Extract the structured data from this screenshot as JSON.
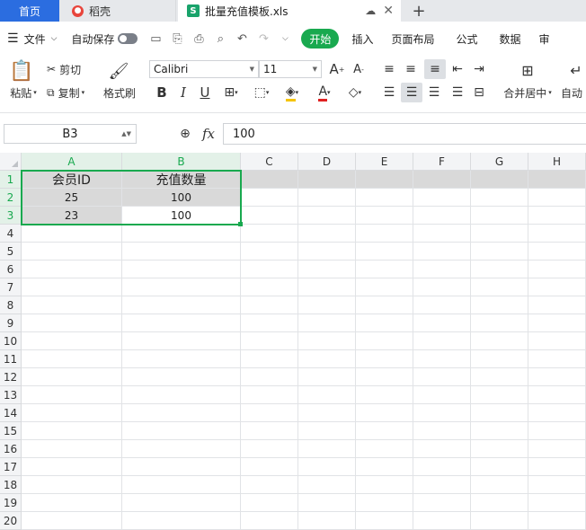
{
  "tabs": {
    "home": "首页",
    "wps": "稻壳",
    "file": "批量充值模板.xls",
    "new_tab": "+"
  },
  "menu": {
    "file": "文件",
    "autosave": "自动保存",
    "items": [
      "开始",
      "插入",
      "页面布局",
      "公式",
      "数据",
      "审"
    ]
  },
  "ribbon": {
    "paste": "粘贴",
    "cut": "剪切",
    "copy": "复制",
    "format_painter": "格式刷",
    "font_name": "Calibri",
    "font_size": "11",
    "merge_center": "合并居中",
    "auto_wrap": "自动"
  },
  "formula_bar": {
    "cell_ref": "B3",
    "fx": "fx",
    "content": "100"
  },
  "columns": [
    "A",
    "B",
    "C",
    "D",
    "E",
    "F",
    "G",
    "H"
  ],
  "rows": [
    "1",
    "2",
    "3",
    "4",
    "5",
    "6",
    "7",
    "8",
    "9",
    "10",
    "11",
    "12",
    "13",
    "14",
    "15",
    "16",
    "17",
    "18",
    "19",
    "20"
  ],
  "cells": {
    "A1": "会员ID",
    "B1": "充值数量",
    "A2": "25",
    "B2": "100",
    "A3": "23",
    "B3": "100"
  },
  "colors": {
    "accent": "#19a94f",
    "home_tab": "#2b6de0",
    "selection": "#19a94f"
  }
}
